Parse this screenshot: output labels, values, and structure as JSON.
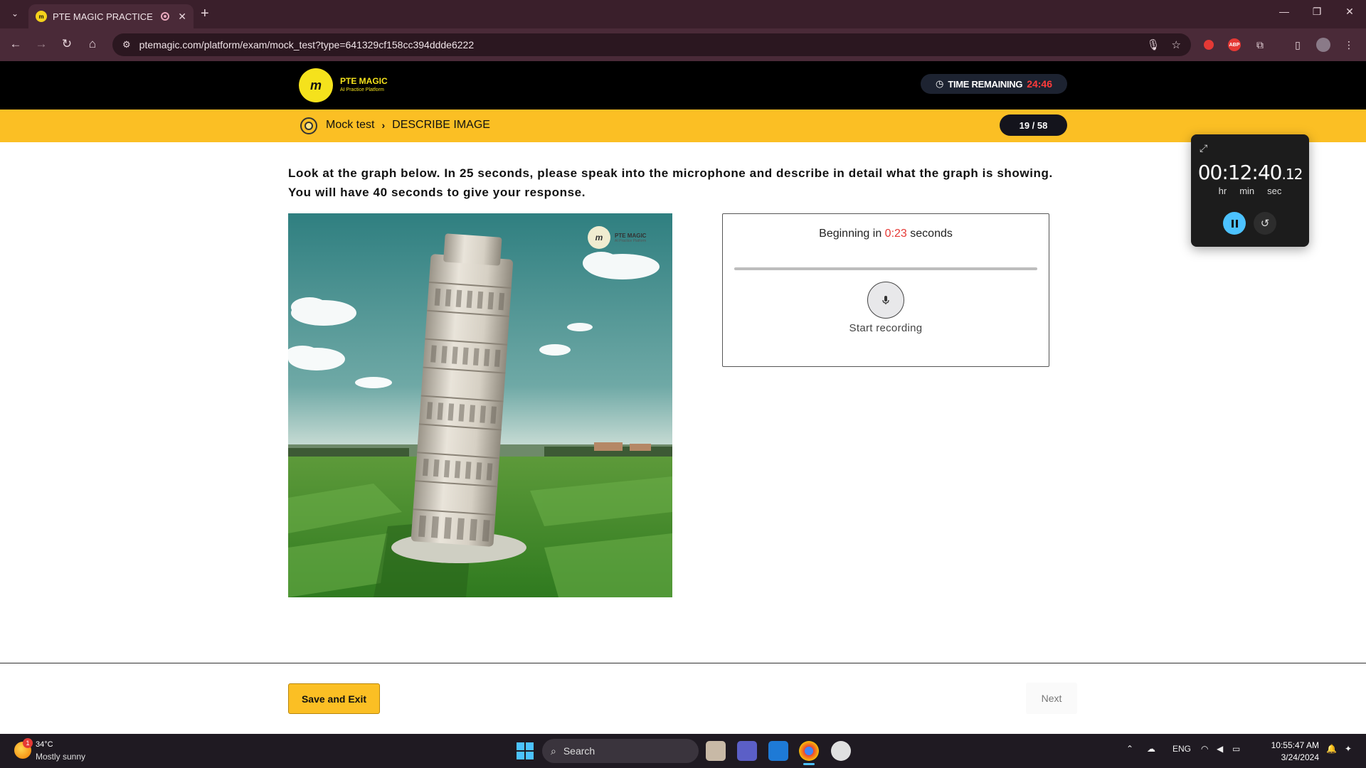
{
  "browser": {
    "tab_title": "PTE MAGIC PRACTICE",
    "tab_close": "✕",
    "new_tab": "+",
    "url": "ptemagic.com/platform/exam/mock_test?type=641329cf158cc394ddde6222",
    "extension_abp": "ABP"
  },
  "header": {
    "logo_mark": "m",
    "brand_name": "PTE MAGIC",
    "brand_tagline": "AI Practice Platform",
    "time_label": "TIME REMAINING",
    "time_value": "24:46"
  },
  "breadcrumb": {
    "parent": "Mock test",
    "separator": "›",
    "current": "DESCRIBE IMAGE",
    "progress": "19 / 58"
  },
  "question": {
    "instructions": "Look at the graph below. In 25 seconds, please speak into the microphone and describe in detail what the graph is showing. You will have 40 seconds to give your response.",
    "image_watermark_name": "PTE MAGIC",
    "image_watermark_tag": "AI Practice Platform"
  },
  "recorder": {
    "status_prefix": "Beginning in",
    "countdown": "0:23",
    "status_suffix": "seconds",
    "button_label": "Start recording",
    "progress": 0
  },
  "stopwatch": {
    "hours": "00",
    "minutes": "12",
    "seconds": "40",
    "hundredths": "12",
    "unit_hr": "hr",
    "unit_min": "min",
    "unit_sec": "sec"
  },
  "footer": {
    "save_exit": "Save and Exit",
    "next": "Next"
  },
  "taskbar": {
    "weather_badge": "1",
    "temperature": "34°C",
    "weather_desc": "Mostly sunny",
    "search_label": "Search",
    "language": "ENG",
    "time": "10:55:47 AM",
    "date": "3/24/2024"
  },
  "colors": {
    "accent_yellow": "#fbbf24",
    "brand_yellow": "#f5e21c",
    "countdown_red": "#e53935",
    "chrome_bg": "#3a1f2b"
  }
}
